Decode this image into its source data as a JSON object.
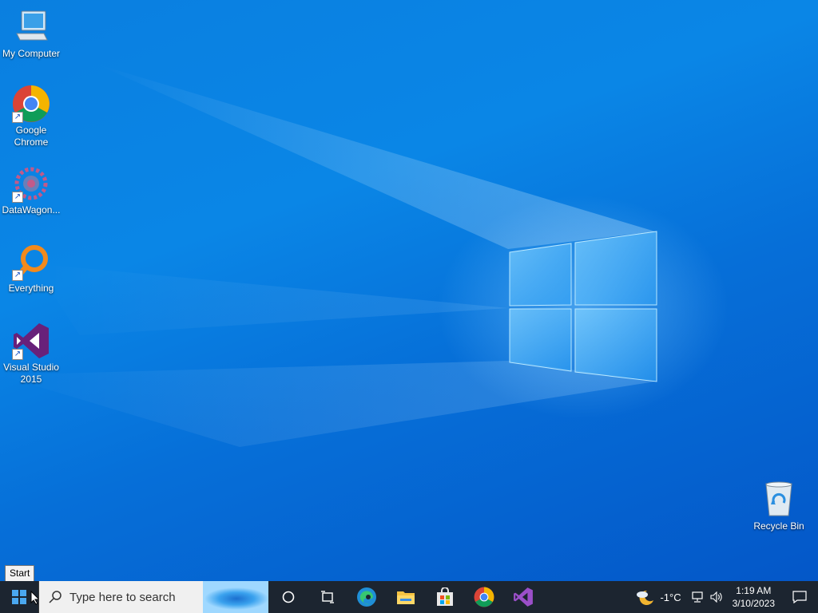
{
  "desktop": {
    "icons": [
      {
        "label": "My Computer",
        "icon": "computer-icon",
        "shortcut": false
      },
      {
        "label": "Google Chrome",
        "icon": "chrome-icon",
        "shortcut": true
      },
      {
        "label": "DataWagon...",
        "icon": "datawagon-icon",
        "shortcut": true
      },
      {
        "label": "Everything",
        "icon": "everything-search-icon",
        "shortcut": true
      },
      {
        "label": "Visual Studio 2015",
        "icon": "visual-studio-icon",
        "shortcut": true
      },
      {
        "label": "Recycle Bin",
        "icon": "recycle-bin-icon",
        "shortcut": false
      }
    ],
    "icon_line1": [
      "My Computer",
      "Google",
      "DataWagon...",
      "Everything",
      "Visual Studio",
      "Recycle Bin"
    ],
    "icon_line2": [
      "",
      "Chrome",
      "",
      "",
      "2015",
      ""
    ]
  },
  "tooltip": {
    "text": "Start"
  },
  "taskbar": {
    "start_icon": "windows-logo-icon",
    "search_placeholder": "Type here to search",
    "pinned": [
      {
        "name": "cortana",
        "icon": "cortana-circle-icon"
      },
      {
        "name": "task-view",
        "icon": "task-view-icon"
      },
      {
        "name": "edge",
        "icon": "edge-icon"
      },
      {
        "name": "file-explorer",
        "icon": "folder-icon"
      },
      {
        "name": "store",
        "icon": "store-bag-icon"
      },
      {
        "name": "chrome",
        "icon": "chrome-icon"
      },
      {
        "name": "visual-studio",
        "icon": "visual-studio-icon"
      }
    ],
    "tray": {
      "weather_icon": "moon-cloud-icon",
      "temperature": "-1°C",
      "network_icon": "network-icon",
      "volume_icon": "volume-icon",
      "time": "1:19 AM",
      "date": "3/10/2023",
      "notification_icon": "notification-icon"
    }
  },
  "colors": {
    "wallpaper_blue": "#0a7fe0",
    "taskbar_bg": "#1c2530",
    "vs_purple": "#68217a"
  }
}
